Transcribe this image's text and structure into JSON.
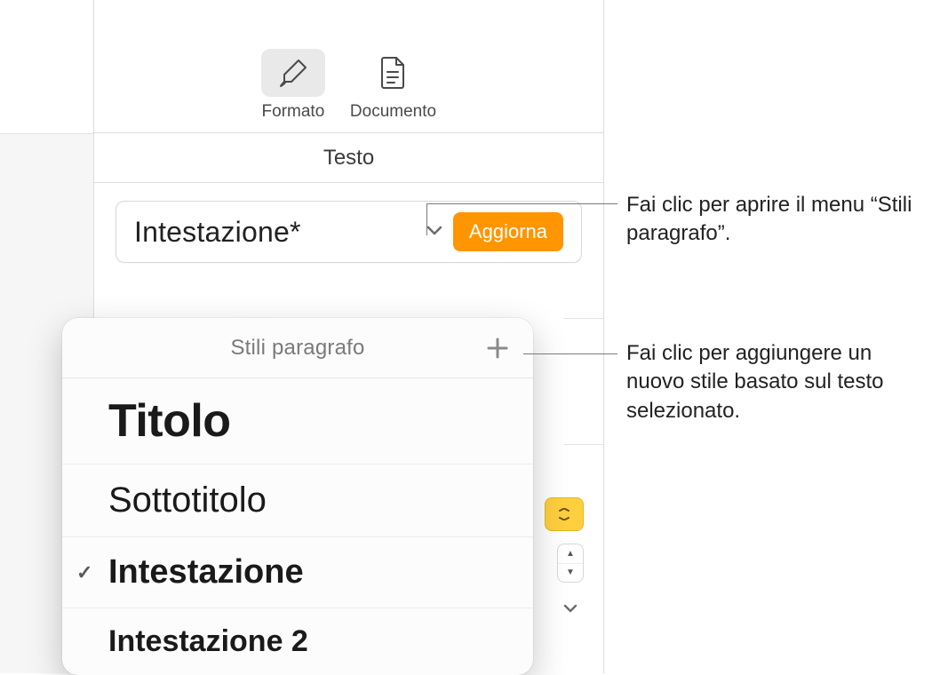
{
  "toolbar": {
    "format": {
      "label": "Formato",
      "icon": "paintbrush-icon"
    },
    "document": {
      "label": "Documento",
      "icon": "document-icon"
    }
  },
  "tabs": {
    "text_tab": "Testo"
  },
  "style_selector": {
    "current": "Intestazione*",
    "update_label": "Aggiorna"
  },
  "popover": {
    "title": "Stili paragrafo",
    "items": [
      {
        "label": "Titolo",
        "selected": false,
        "variant": "title"
      },
      {
        "label": "Sottotitolo",
        "selected": false,
        "variant": "subtitle"
      },
      {
        "label": "Intestazione",
        "selected": true,
        "variant": "heading"
      },
      {
        "label": "Intestazione 2",
        "selected": false,
        "variant": "heading2"
      }
    ]
  },
  "callouts": {
    "open_menu": "Fai clic per aprire il menu “Stili paragrafo”.",
    "add_style": "Fai clic per aggiungere un nuovo stile basato sul testo selezionato."
  },
  "colors": {
    "accent": "#ff9500"
  }
}
